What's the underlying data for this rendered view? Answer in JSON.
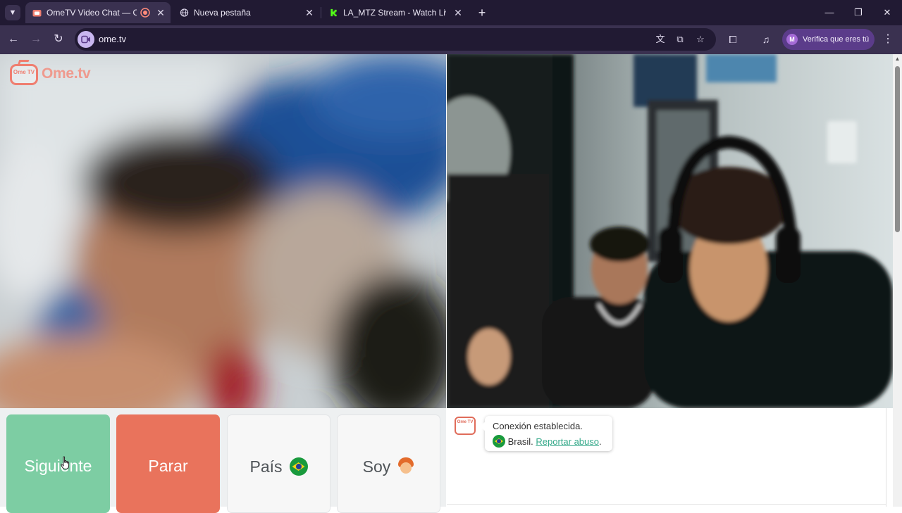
{
  "browser": {
    "tabs": [
      {
        "title": "OmeTV Video Chat — Ome",
        "active": true,
        "recording": true
      },
      {
        "title": "Nueva pestaña",
        "active": false
      },
      {
        "title": "LA_MTZ Stream - Watch Live o",
        "active": false
      }
    ],
    "url": "ome.tv",
    "profile_initial": "M",
    "profile_label": "Verifica que eres tú"
  },
  "page": {
    "logo_text": "Ome.tv",
    "logo_mini": "Ome TV",
    "controls": {
      "next_label": "Siguiente",
      "stop_label": "Parar",
      "country_label": "País",
      "gender_label": "Soy"
    },
    "chat": {
      "status_text": "Conexión establecida.",
      "country_text": "Brasil.",
      "report_link": "Reportar abuso",
      "report_suffix": "."
    }
  },
  "colors": {
    "tabbar_bg": "#211a33",
    "toolbar_bg": "#3a3150",
    "next_button": "#7dcda3",
    "stop_button": "#e9735c",
    "logo": "#ef7e70",
    "link": "#36a98a"
  },
  "icons": {
    "tab_search": "chevron-down-icon",
    "back": "arrow-left-icon",
    "forward": "arrow-right-icon",
    "reload": "reload-icon",
    "translate": "translate-icon",
    "cast": "cast-icon",
    "bookmark": "star-icon",
    "extensions": "puzzle-icon",
    "media": "media-controls-icon",
    "menu": "kebab-menu-icon"
  }
}
